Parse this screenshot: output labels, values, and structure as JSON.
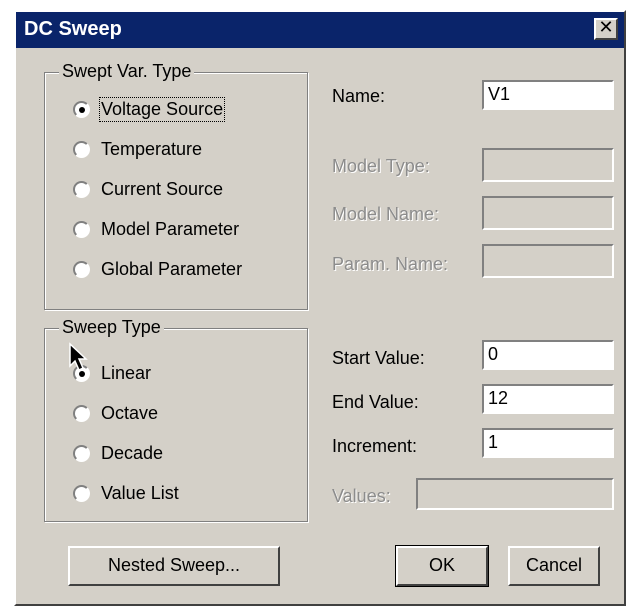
{
  "window": {
    "title": "DC Sweep",
    "close_symbol": "✕"
  },
  "swept_var_type": {
    "label": "Swept Var. Type",
    "options": [
      "Voltage Source",
      "Temperature",
      "Current Source",
      "Model Parameter",
      "Global Parameter"
    ],
    "selected": "Voltage Source"
  },
  "sweep_type": {
    "label": "Sweep Type",
    "options": [
      "Linear",
      "Octave",
      "Decade",
      "Value List"
    ],
    "selected": "Linear"
  },
  "fields": {
    "name": {
      "label": "Name:",
      "value": "V1"
    },
    "model_type": {
      "label": "Model Type:",
      "value": ""
    },
    "model_name": {
      "label": "Model Name:",
      "value": ""
    },
    "param_name": {
      "label": "Param. Name:",
      "value": ""
    },
    "start_value": {
      "label": "Start Value:",
      "value": "0"
    },
    "end_value": {
      "label": "End Value:",
      "value": "12"
    },
    "increment": {
      "label": "Increment:",
      "value": "1"
    },
    "values": {
      "label": "Values:",
      "value": ""
    }
  },
  "buttons": {
    "nested_sweep": "Nested Sweep...",
    "ok": "OK",
    "cancel": "Cancel"
  },
  "colors": {
    "titlebar": "#0a246a",
    "face": "#d4d0c8",
    "disabled_text": "#8c8c8c"
  }
}
